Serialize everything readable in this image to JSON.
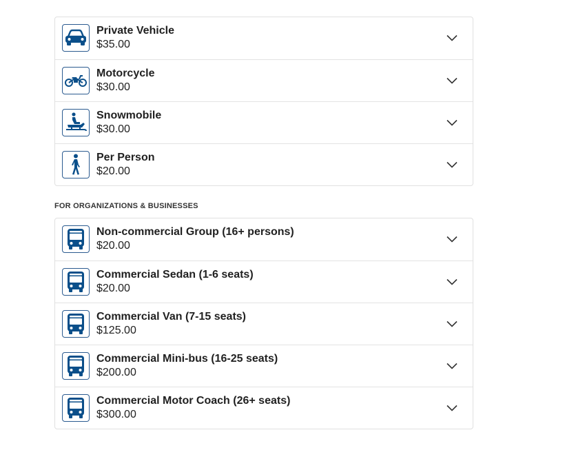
{
  "colors": {
    "icon": "#0b4f8a",
    "border": "#e0e0e0",
    "text": "#212121"
  },
  "individual_passes": [
    {
      "title": "Private Vehicle",
      "price": "$35.00",
      "icon": "car-icon"
    },
    {
      "title": "Motorcycle",
      "price": "$30.00",
      "icon": "motorcycle-icon"
    },
    {
      "title": "Snowmobile",
      "price": "$30.00",
      "icon": "snowmobile-icon"
    },
    {
      "title": "Per Person",
      "price": "$20.00",
      "icon": "person-walking-icon"
    }
  ],
  "business_section": {
    "heading": "FOR ORGANIZATIONS & BUSINESSES"
  },
  "business_passes": [
    {
      "title": "Non-commercial Group (16+ persons)",
      "price": "$20.00",
      "icon": "bus-icon"
    },
    {
      "title": "Commercial Sedan (1-6 seats)",
      "price": "$20.00",
      "icon": "bus-icon"
    },
    {
      "title": "Commercial Van (7-15 seats)",
      "price": "$125.00",
      "icon": "bus-icon"
    },
    {
      "title": "Commercial Mini-bus (16-25 seats)",
      "price": "$200.00",
      "icon": "bus-icon"
    },
    {
      "title": "Commercial Motor Coach (26+ seats)",
      "price": "$300.00",
      "icon": "bus-icon"
    }
  ]
}
